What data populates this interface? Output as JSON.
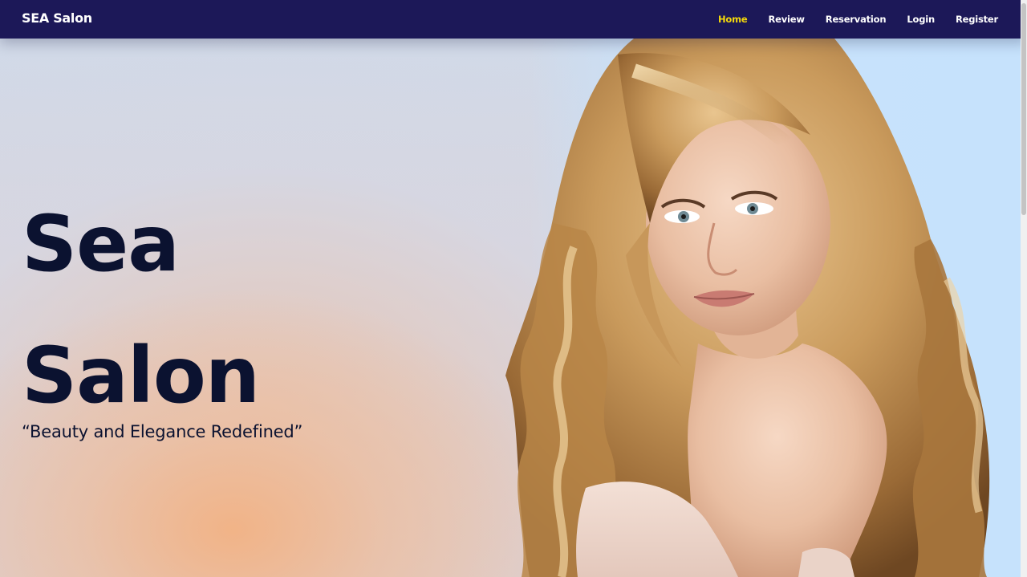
{
  "navbar": {
    "brand": "SEA Salon",
    "links": [
      {
        "label": "Home",
        "active": true
      },
      {
        "label": "Review",
        "active": false
      },
      {
        "label": "Reservation",
        "active": false
      },
      {
        "label": "Login",
        "active": false
      },
      {
        "label": "Register",
        "active": false
      }
    ],
    "active_color": "#f5d90a",
    "background": "#1c1858"
  },
  "hero": {
    "title_line1": "Sea",
    "title_line2": "Salon",
    "tagline": "“Beauty and Elegance Redefined”",
    "image_icon": "woman-portrait-illustration"
  },
  "colors": {
    "title": "#0b1230",
    "hero_right_background": "#c6e2fc",
    "peach_glow": "#f2b284"
  }
}
